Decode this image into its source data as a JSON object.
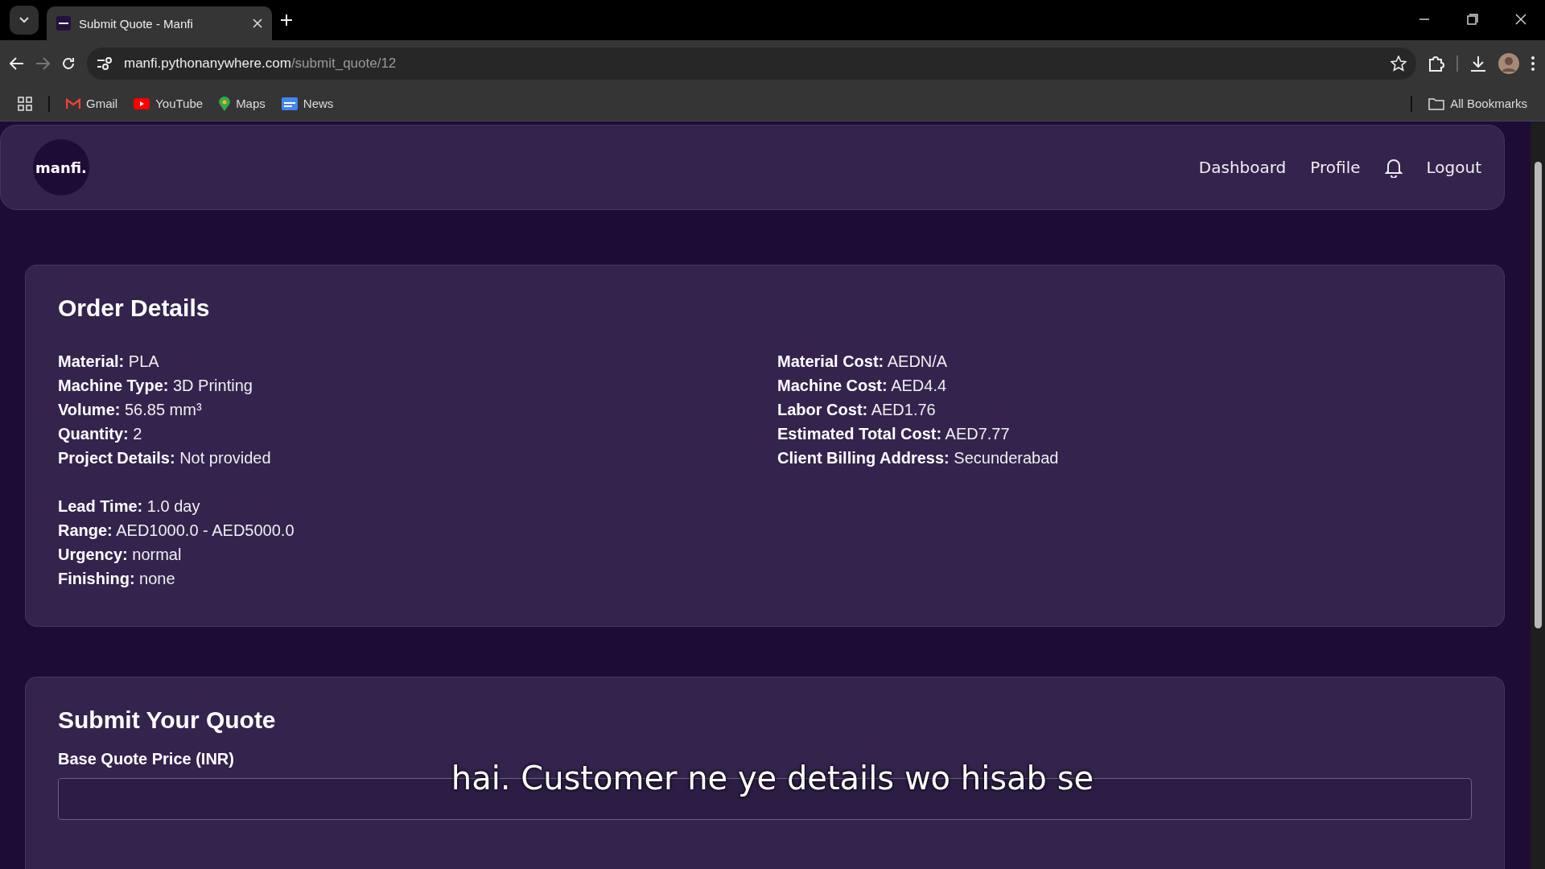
{
  "browser": {
    "tab": {
      "title": "Submit Quote - Manfi"
    },
    "url": {
      "host": "manfi.pythonanywhere.com",
      "path": "/submit_quote/12"
    },
    "bookmarks": [
      {
        "label": "Gmail",
        "kind": "gmail"
      },
      {
        "label": "YouTube",
        "kind": "youtube"
      },
      {
        "label": "Maps",
        "kind": "maps"
      },
      {
        "label": "News",
        "kind": "news"
      }
    ],
    "all_bookmarks": "All Bookmarks"
  },
  "header": {
    "logo": "manfi.",
    "nav": [
      {
        "label": "Dashboard",
        "kind": "link"
      },
      {
        "label": "Profile",
        "kind": "link"
      },
      {
        "kind": "bell"
      },
      {
        "label": "Logout",
        "kind": "link"
      }
    ]
  },
  "order_details": {
    "title": "Order Details",
    "left": [
      {
        "label": "Material:",
        "value": "PLA"
      },
      {
        "label": "Machine Type:",
        "value": "3D Printing"
      },
      {
        "label": "Volume:",
        "value": "56.85 mm³"
      },
      {
        "label": "Quantity:",
        "value": "2"
      },
      {
        "label": "Project Details:",
        "value": "Not provided"
      },
      {
        "kind": "gap"
      },
      {
        "label": "Lead Time:",
        "value": "1.0 day"
      },
      {
        "label": "Range:",
        "value": "AED1000.0 - AED5000.0"
      },
      {
        "label": "Urgency:",
        "value": "normal"
      },
      {
        "label": "Finishing:",
        "value": "none"
      }
    ],
    "right": [
      {
        "label": "Material Cost:",
        "value": "AEDN/A"
      },
      {
        "label": "Machine Cost:",
        "value": "AED4.4"
      },
      {
        "label": "Labor Cost:",
        "value": "AED1.76"
      },
      {
        "label": "Estimated Total Cost:",
        "value": "AED7.77"
      },
      {
        "label": "Client Billing Address:",
        "value": "Secunderabad"
      }
    ]
  },
  "quote_form": {
    "title": "Submit Your Quote",
    "field_label": "Base Quote Price (INR)"
  },
  "subtitle": "hai. Customer ne ye details wo hisab se"
}
